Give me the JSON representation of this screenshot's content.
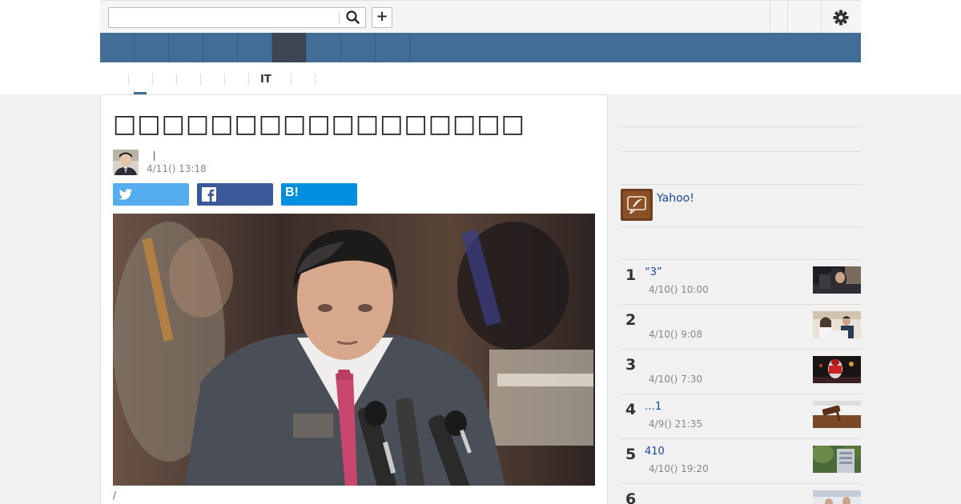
{
  "search": {
    "placeholder": "",
    "value": ""
  },
  "header": {
    "plus_label": "+"
  },
  "subnav": {
    "items": [
      "",
      "",
      "",
      "",
      "",
      "IT",
      ""
    ]
  },
  "article": {
    "title": "□□□□□□□□□□□□□□□□□",
    "date": "4/11() 13:18",
    "caption": "/",
    "share_hatena_label": "B!"
  },
  "sidebar": {
    "yahoo_label": "Yahoo!",
    "ranking": [
      {
        "rank": "1",
        "title": "“3”",
        "date": "4/10() 10:00"
      },
      {
        "rank": "2",
        "title": "",
        "date": "4/10() 9:08"
      },
      {
        "rank": "3",
        "title": "",
        "date": "4/10() 7:30"
      },
      {
        "rank": "4",
        "title": "…1",
        "date": "4/9() 21:35"
      },
      {
        "rank": "5",
        "title": "410",
        "date": "4/10() 19:20"
      },
      {
        "rank": "6",
        "title": "",
        "date": ""
      }
    ]
  },
  "colors": {
    "nav_blue": "#416d96",
    "nav_active": "#3d4452",
    "twitter": "#55acee",
    "facebook": "#3b5998",
    "hatena": "#008fde",
    "link": "#1a47a0"
  },
  "icons": [
    "search-icon",
    "plus-icon",
    "gear-icon",
    "twitter-icon",
    "facebook-icon",
    "hatena-bookmark-icon"
  ]
}
